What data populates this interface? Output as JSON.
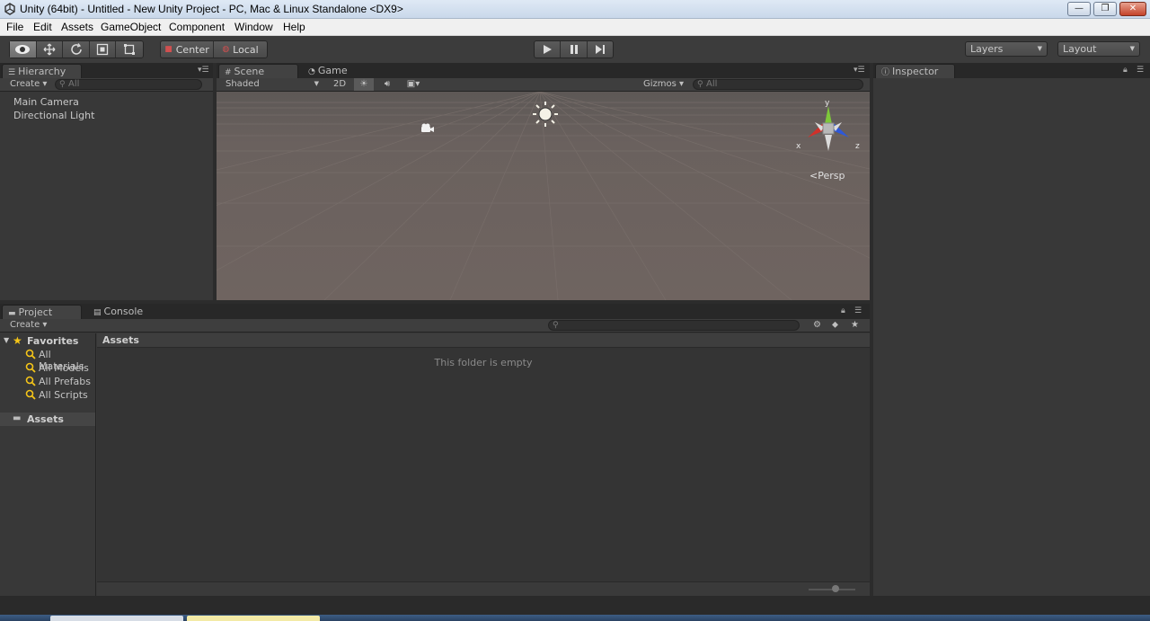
{
  "window": {
    "title": "Unity (64bit) - Untitled - New Unity Project - PC, Mac & Linux Standalone <DX9>",
    "minimize_label": "—",
    "maximize_label": "❐",
    "close_label": "✕"
  },
  "menu": [
    "File",
    "Edit",
    "Assets",
    "GameObject",
    "Component",
    "Window",
    "Help"
  ],
  "toolbar": {
    "pivot_center": "Center",
    "pivot_local": "Local",
    "layers": "Layers",
    "layout": "Layout"
  },
  "hierarchy": {
    "tab": "Hierarchy",
    "create": "Create",
    "search_placeholder": "All",
    "items": [
      "Main Camera",
      "Directional Light"
    ]
  },
  "scene": {
    "tab_scene": "Scene",
    "tab_game": "Game",
    "shading": "Shaded",
    "mode_2d": "2D",
    "gizmos": "Gizmos",
    "search_placeholder": "All",
    "persp": "Persp",
    "axis_y": "y",
    "axis_x": "x",
    "axis_z": "z"
  },
  "inspector": {
    "tab": "Inspector"
  },
  "project": {
    "tab_project": "Project",
    "tab_console": "Console",
    "create": "Create",
    "favorites": "Favorites",
    "favorites_items": [
      "All Materials",
      "All Models",
      "All Prefabs",
      "All Scripts"
    ],
    "assets_root": "Assets",
    "assets_header": "Assets",
    "empty_message": "This folder is empty"
  },
  "colors": {
    "accent_star": "#f5c518",
    "scene_bg": "#6b625f",
    "axis_y": "#7ec83a",
    "axis_x": "#d0302a",
    "axis_z": "#2e58d8"
  }
}
